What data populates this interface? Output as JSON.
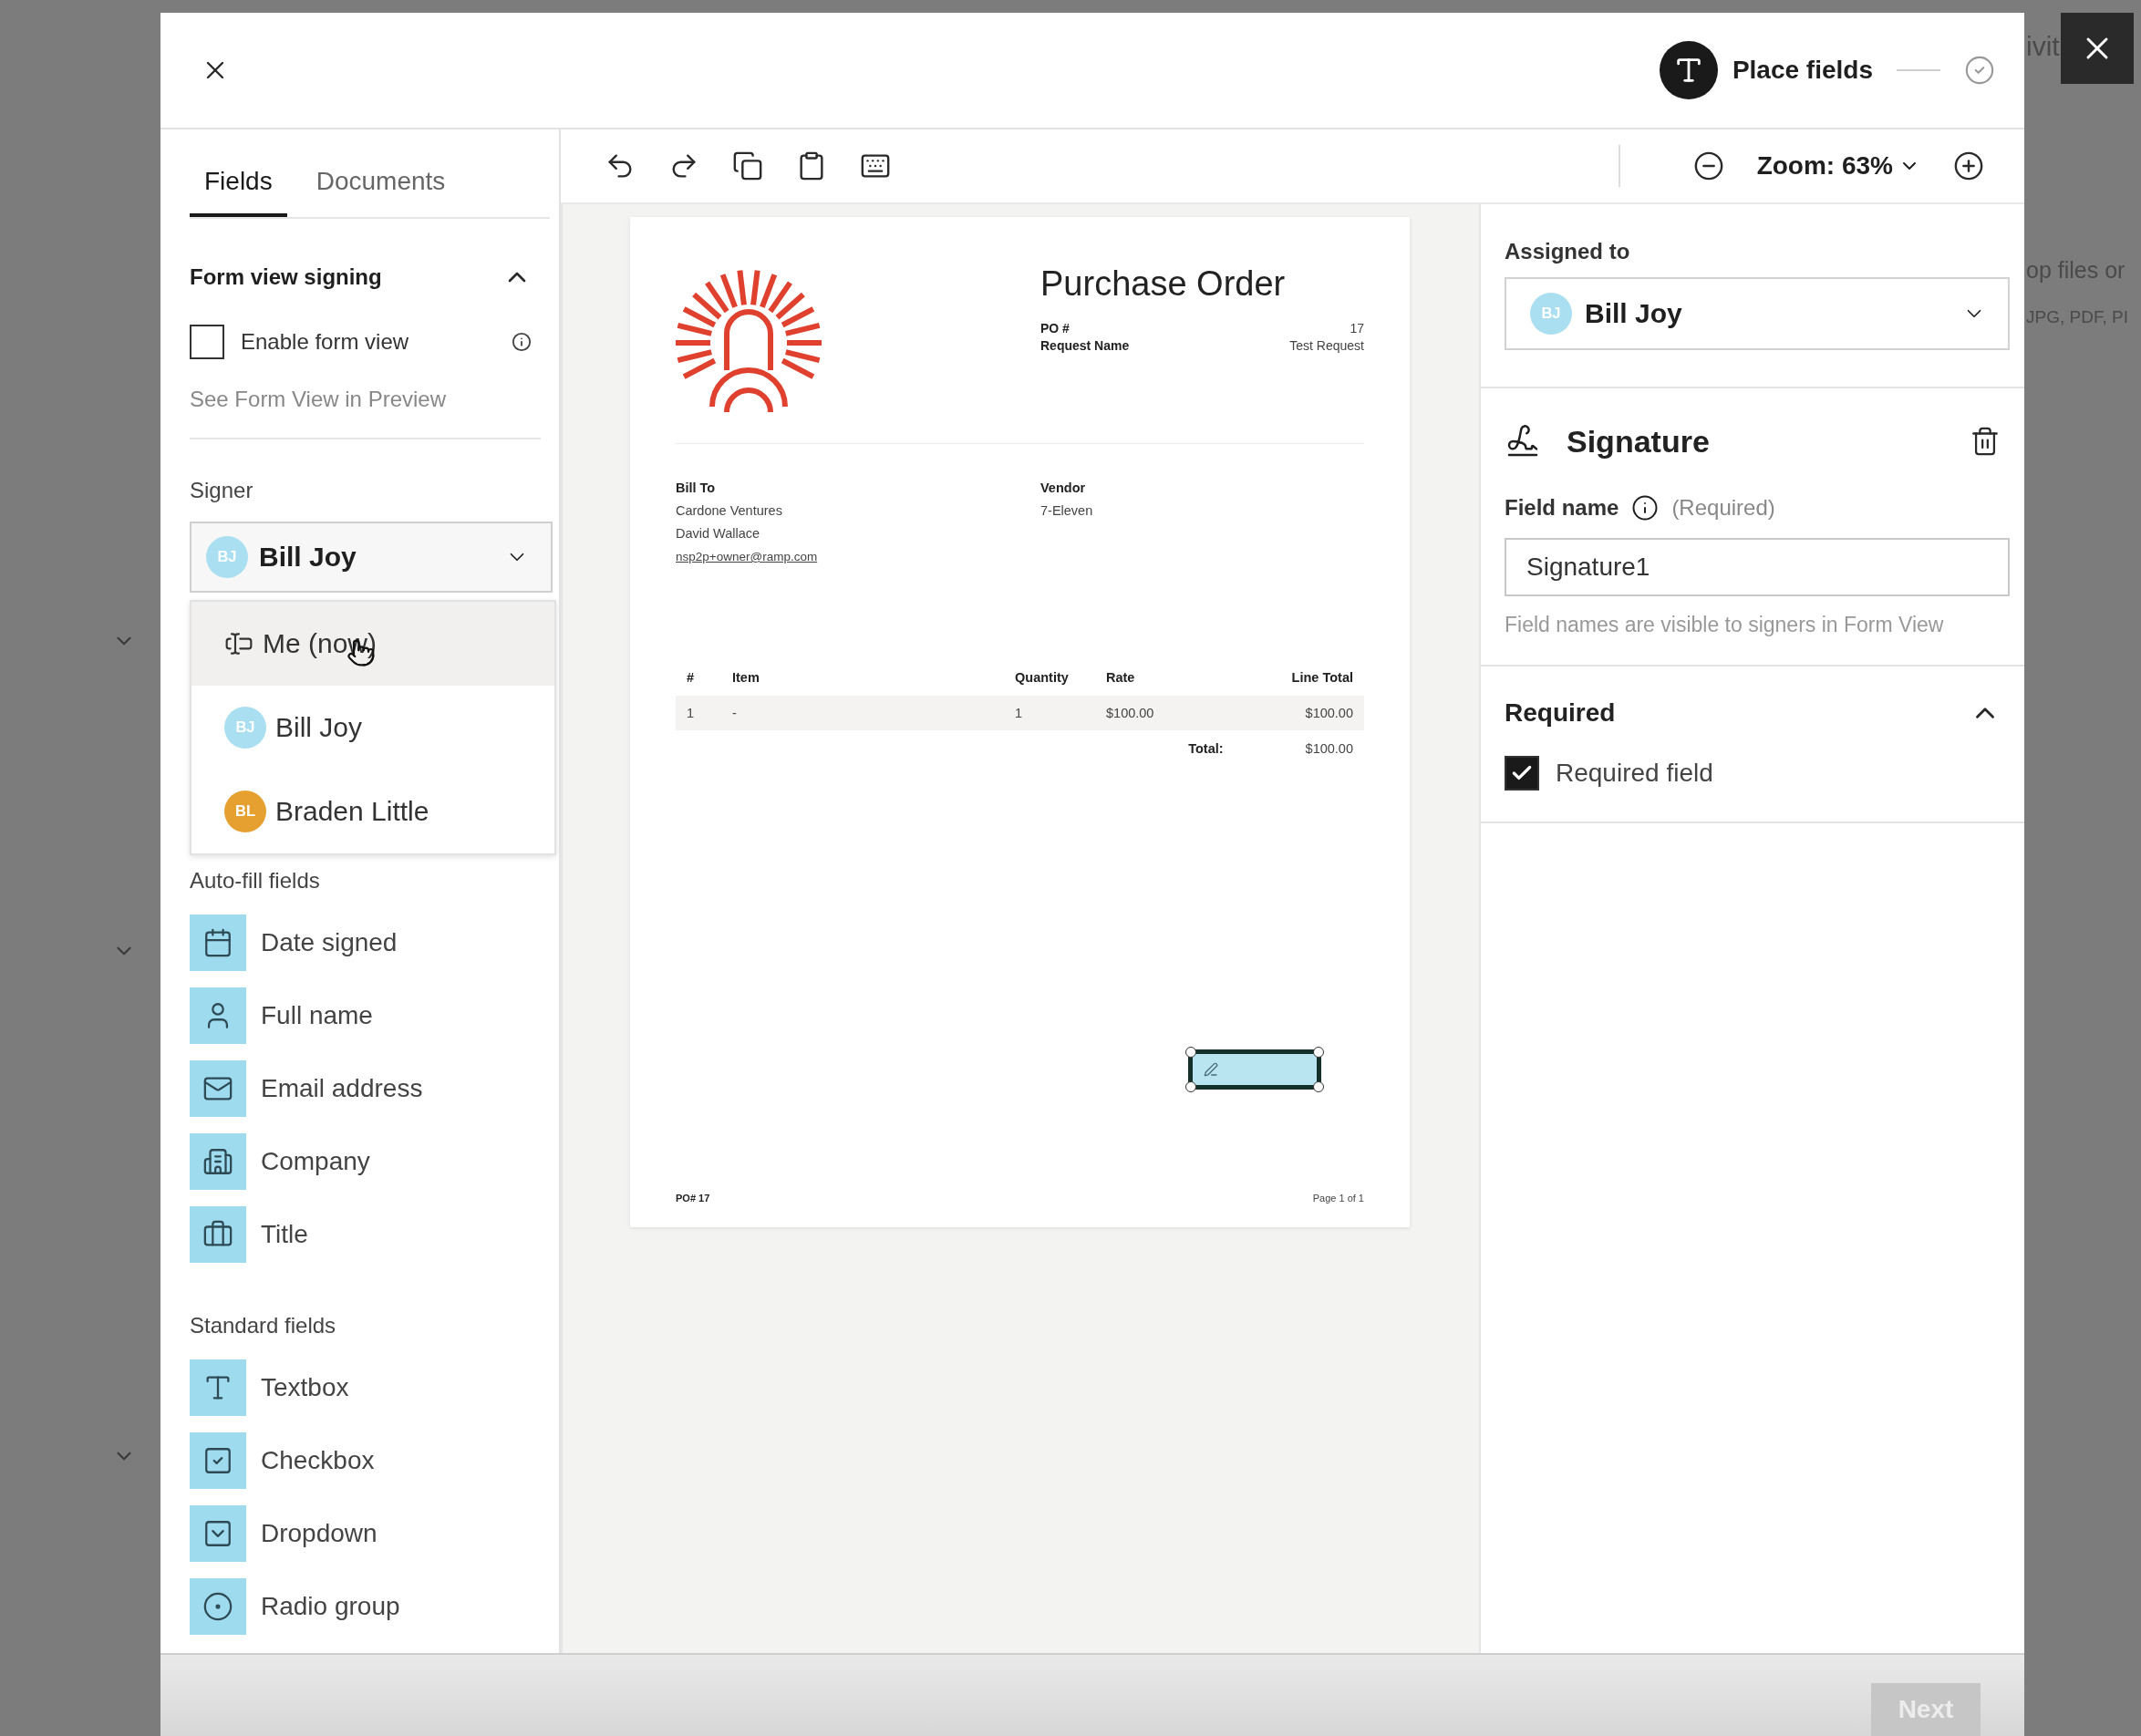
{
  "header": {
    "step": {
      "label": "Place fields"
    }
  },
  "left_panel": {
    "tabs": [
      {
        "label": "Fields",
        "selected": true
      },
      {
        "label": "Documents",
        "selected": false
      }
    ],
    "form_view": {
      "title": "Form view signing",
      "expanded": true,
      "checkbox_label": "Enable form view",
      "checked": false,
      "link": "See Form View in Preview"
    },
    "signer": {
      "label": "Signer",
      "initials": "BJ",
      "name": "Bill Joy",
      "color": "#a9dff0",
      "expanded": true,
      "options": [
        {
          "kind": "me",
          "label": "Me (now)",
          "hovered": true
        },
        {
          "kind": "person",
          "initials": "BJ",
          "label": "Bill Joy",
          "color": "#a9dff0",
          "hovered": false
        },
        {
          "kind": "person",
          "initials": "BL",
          "label": "Braden Little",
          "color": "#e6a030",
          "hovered": false
        }
      ]
    },
    "autofill": {
      "title": "Auto-fill fields",
      "items": [
        {
          "kind": "calendar",
          "label": "Date signed"
        },
        {
          "kind": "person",
          "label": "Full name"
        },
        {
          "kind": "mail",
          "label": "Email address"
        },
        {
          "kind": "building",
          "label": "Company"
        },
        {
          "kind": "briefcase",
          "label": "Title"
        }
      ]
    },
    "standard": {
      "title": "Standard fields",
      "items": [
        {
          "kind": "textbox",
          "label": "Textbox"
        },
        {
          "kind": "checkbox",
          "label": "Checkbox"
        },
        {
          "kind": "dropdown",
          "label": "Dropdown"
        },
        {
          "kind": "radio",
          "label": "Radio group"
        }
      ]
    }
  },
  "toolbar": {
    "zoom": "Zoom: 63%"
  },
  "document": {
    "title": "Purchase Order",
    "meta": [
      {
        "label": "PO #",
        "value": "17"
      },
      {
        "label": "Request Name",
        "value": "Test Request"
      }
    ],
    "bill_to": {
      "heading": "Bill To",
      "lines": [
        "Cardone Ventures",
        "David Wallace"
      ],
      "email": "nsp2p+owner@ramp.com"
    },
    "vendor": {
      "heading": "Vendor",
      "lines": [
        "7-Eleven"
      ]
    },
    "table": {
      "columns": [
        "#",
        "Item",
        "Quantity",
        "Rate",
        "Line Total"
      ],
      "rows": [
        [
          "1",
          "-",
          "1",
          "$100.00",
          "$100.00"
        ]
      ],
      "total_label": "Total:",
      "total": "$100.00"
    },
    "signature_field": {
      "selected": true
    },
    "footer_left": "PO# 17",
    "footer_right": "Page 1 of 1"
  },
  "right_panel": {
    "assigned_label": "Assigned to",
    "assignee": {
      "initials": "BJ",
      "name": "Bill Joy",
      "color": "#a9dff0"
    },
    "field_type": "Signature",
    "field_name_label": "Field name",
    "required_hint": "(Required)",
    "field_name": "Signature1",
    "helper": "Field names are visible to signers in Form View",
    "required_section": {
      "title": "Required",
      "expanded": true,
      "checkbox_label": "Required field",
      "checked": true
    }
  },
  "footer": {
    "next": {
      "label": "Next",
      "disabled": true
    }
  },
  "backdrop": {
    "texts": [
      "ivit",
      "op files or",
      "JPG, PDF, PI"
    ]
  }
}
